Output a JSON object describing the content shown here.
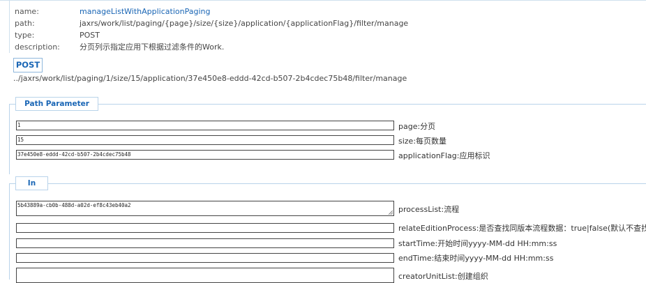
{
  "meta": {
    "name_label": "name:",
    "name_value": "manageListWithApplicationPaging",
    "path_label": "path:",
    "path_value": "jaxrs/work/list/paging/{page}/size/{size}/application/{applicationFlag}/filter/manage",
    "type_label": "type:",
    "type_value": "POST",
    "description_label": "description:",
    "description_value": "分页列示指定应用下根据过滤条件的Work."
  },
  "request": {
    "method_button": "POST",
    "url": "../jaxrs/work/list/paging/1/size/15/application/37e450e8-eddd-42cd-b507-2b4cdec75b48/filter/manage"
  },
  "path_parameter": {
    "legend": "Path Parameter",
    "fields": [
      {
        "value": "1",
        "label": "page:分页"
      },
      {
        "value": "15",
        "label": "size:每页数量"
      },
      {
        "value": "37e450e8-eddd-42cd-b507-2b4cdec75b48",
        "label": "applicationFlag:应用标识"
      }
    ]
  },
  "in": {
    "legend": "In",
    "fields": [
      {
        "value": "5b43889a-cb0b-488d-a02d-ef8c43eb40a2",
        "label": "processList:流程"
      },
      {
        "value": "",
        "label": "relateEditionProcess:是否查找同版本流程数据：true|false(默认不查找)"
      },
      {
        "value": "",
        "label": "startTime:开始时间yyyy-MM-dd HH:mm:ss"
      },
      {
        "value": "",
        "label": "endTime:结束时间yyyy-MM-dd HH:mm:ss"
      },
      {
        "value": "",
        "label": "creatorUnitList:创建组织"
      }
    ]
  }
}
